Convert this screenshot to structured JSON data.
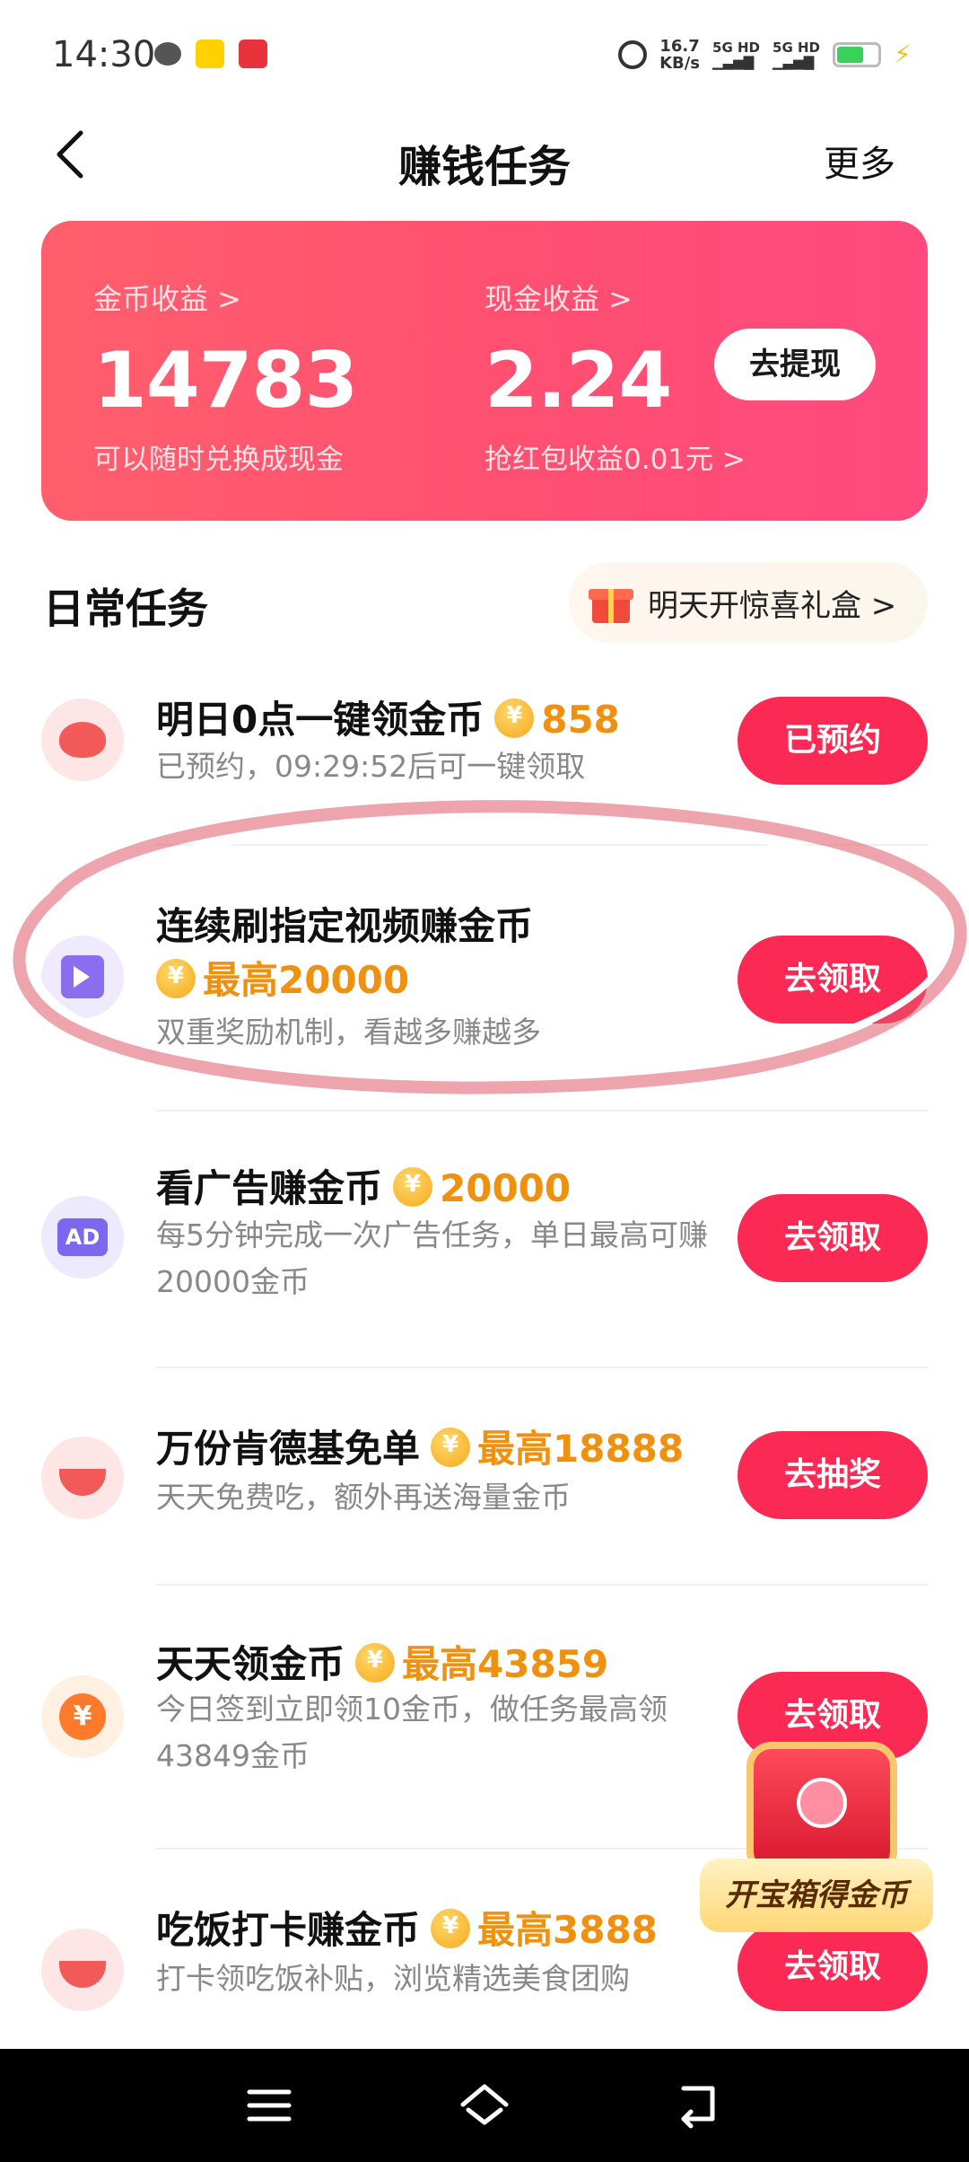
{
  "status_bar": {
    "time": "14:30",
    "net_speed_value": "16.7",
    "net_speed_unit": "KB/s",
    "sim1": "5G HD",
    "sim2": "5G HD"
  },
  "header": {
    "title": "赚钱任务",
    "more_label": "更多"
  },
  "earnings": {
    "coin_label": "金币收益 >",
    "coin_value": "14783",
    "coin_sub": "可以随时兑换成现金",
    "cash_label": "现金收益 >",
    "cash_value": "2.24",
    "cash_sub": "抢红包收益0.01元 >",
    "withdraw_label": "去提现"
  },
  "daily": {
    "title": "日常任务",
    "surprise_label": "明天开惊喜礼盒 >"
  },
  "tasks": [
    {
      "title": "明日0点一键领金币",
      "reward": "858",
      "desc": "已预约，09:29:52后可一键领取",
      "button": "已预约",
      "icon": "piggy-bank-icon"
    },
    {
      "title": "连续刷指定视频赚金币",
      "reward": "最高20000",
      "desc": "双重奖励机制，看越多赚越多",
      "button": "去领取",
      "icon": "video-icon"
    },
    {
      "title": "看广告赚金币",
      "reward": "20000",
      "desc": "每5分钟完成一次广告任务，单日最高可赚20000金币",
      "button": "去领取",
      "icon": "ad-icon"
    },
    {
      "title": "万份肯德基免单",
      "reward": "最高18888",
      "desc": "天天免费吃，额外再送海量金币",
      "button": "去抽奖",
      "icon": "bowl-icon"
    },
    {
      "title": "天天领金币",
      "reward": "最高43859",
      "desc": "今日签到立即领10金币，做任务最高领43849金币",
      "button": "去领取",
      "icon": "yen-coin-icon"
    },
    {
      "title": "吃饭打卡赚金币",
      "reward": "最高3888",
      "desc": "打卡领吃饭补贴，浏览精选美食团购",
      "button": "去领取",
      "icon": "bowl-icon"
    }
  ],
  "treasure": {
    "label": "开宝箱得金币"
  },
  "colors": {
    "accent": "#fa2a55",
    "card_gradient_start": "#ff5f6d",
    "card_gradient_end": "#ff4a7f",
    "reward_orange": "#f0900f"
  }
}
